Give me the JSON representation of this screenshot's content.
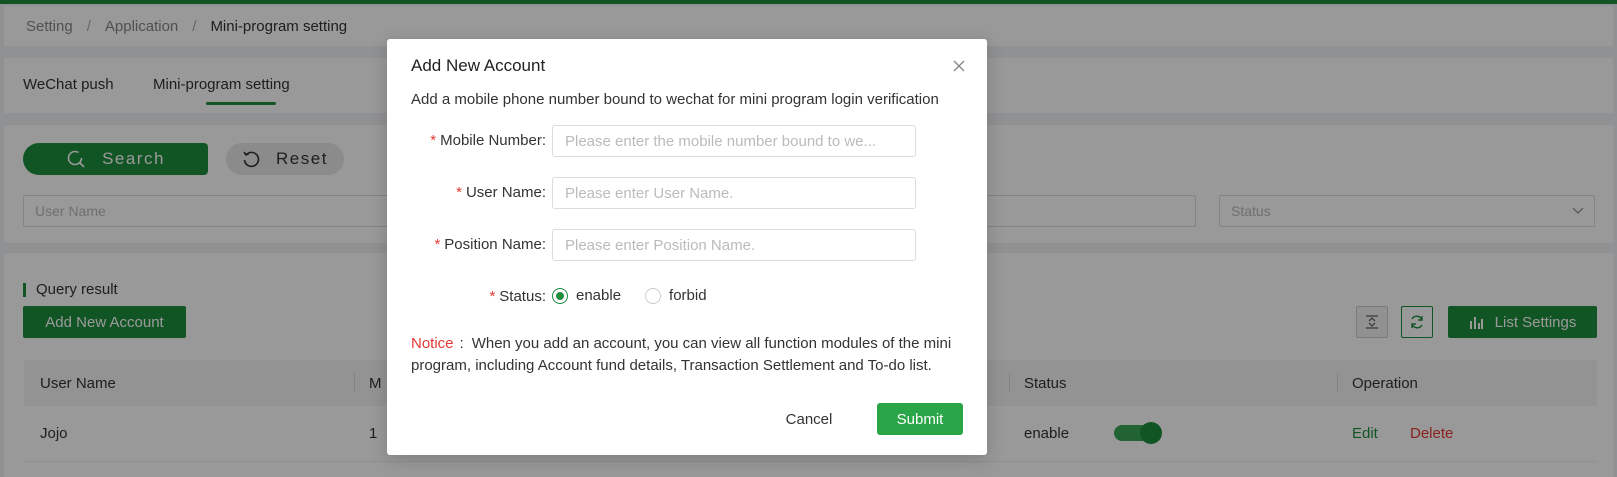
{
  "breadcrumb": {
    "items": [
      "Setting",
      "Application",
      "Mini-program setting"
    ],
    "separator": "/"
  },
  "tabs": [
    {
      "label": "WeChat push",
      "active": false
    },
    {
      "label": "Mini-program setting",
      "active": true
    }
  ],
  "search": {
    "search_label": "Search",
    "reset_label": "Reset",
    "username_placeholder": "User Name",
    "status_placeholder": "Status"
  },
  "results": {
    "title": "Query result",
    "add_label": "Add New Account",
    "list_settings_label": "List Settings",
    "columns": [
      "User Name",
      "M",
      "Status",
      "Operation"
    ],
    "rows": [
      {
        "user_name": "Jojo",
        "mobile": "1",
        "status": "enable",
        "enabled": true,
        "edit": "Edit",
        "delete": "Delete"
      }
    ]
  },
  "modal": {
    "title": "Add New Account",
    "description": "Add a mobile phone number bound to wechat for mini program login verification",
    "required_mark": "*",
    "fields": {
      "mobile": {
        "label": "Mobile Number:",
        "placeholder": "Please enter the mobile number bound to we...",
        "value": ""
      },
      "username": {
        "label": "User Name:",
        "placeholder": "Please enter User Name.",
        "value": ""
      },
      "position": {
        "label": "Position Name:",
        "placeholder": "Please enter Position Name.",
        "value": ""
      },
      "status": {
        "label": "Status:",
        "options": [
          "enable",
          "forbid"
        ],
        "selected": "enable"
      }
    },
    "notice_key": "Notice",
    "notice_sep": ":",
    "notice_text": "When you add an account, you can view all function modules of the mini program, including Account fund details, Transaction Settlement and To-do list.",
    "cancel_label": "Cancel",
    "submit_label": "Submit"
  },
  "colors": {
    "primary": "#1e8e3e",
    "danger": "#e53935",
    "submit": "#2aa548"
  }
}
